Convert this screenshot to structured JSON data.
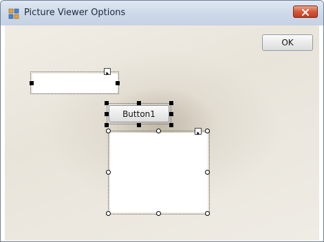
{
  "window": {
    "title": "Picture Viewer Options",
    "accent": "#c4d2e4",
    "close_color": "#d4583a"
  },
  "toolbar": {
    "ok_label": "OK"
  },
  "designer": {
    "button1_label": "Button1",
    "icons": [
      "form-app-icon",
      "close-icon",
      "smart-tag-arrow-icon"
    ]
  }
}
